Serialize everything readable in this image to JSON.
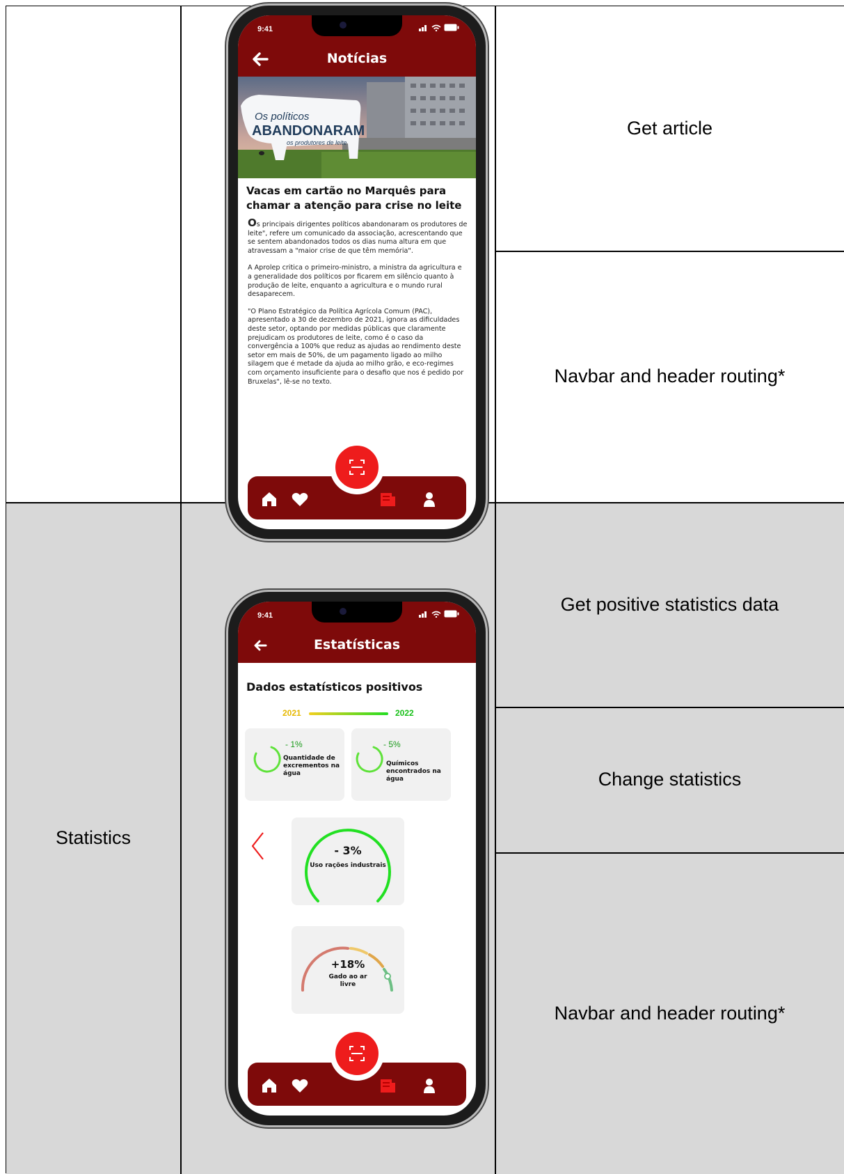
{
  "rows": [
    {
      "feature": "",
      "phone": {
        "status_time": "9:41",
        "header_title": "Notícias",
        "photo_text": {
          "line1": "Os políticos",
          "line2": "ABANDONARAM",
          "line3": "os produtores de leite"
        },
        "article_title": "Vacas em cartão no Marquês para chamar a atenção para crise no leite",
        "paragraphs": [
          {
            "dropcap": "O",
            "text": "s principais dirigentes políticos abandonaram os produtores de leite\", refere um comunicado da associação, acrescentando que se sentem abandonados todos os dias numa altura em que atravessam a \"maior crise de que têm memória\"."
          },
          {
            "dropcap": "",
            "text": "A Aprolep critica o primeiro-ministro, a ministra da agricultura e a generalidade dos políticos por ficarem em silêncio quanto à produção de leite, enquanto a agricultura e o mundo rural desaparecem."
          },
          {
            "dropcap": "",
            "text": "\"O Plano Estratégico da Política Agrícola Comum (PAC), apresentado a 30 de dezembro de 2021, ignora as dificuldades deste setor, optando por medidas públicas que claramente prejudicam os produtores de leite, como é o caso da convergência a 100% que reduz as ajudas ao rendimento deste setor em mais de 50%, de um pagamento ligado ao milho silagem que é metade da ajuda ao milho grão, e eco-regimes com orçamento insuficiente para o desafio que nos é pedido por Bruxelas\", lê-se no texto."
          }
        ]
      },
      "actions": [
        "Get article",
        "Navbar and header routing*"
      ]
    },
    {
      "feature": "Statistics",
      "phone": {
        "status_time": "9:41",
        "header_title": "Estatísticas",
        "section_title": "Dados estatísticos positivos",
        "legend": {
          "from": "2021",
          "to": "2022"
        },
        "cards": [
          {
            "value": "- 1%",
            "label": "Quantidade de excrementos na água"
          },
          {
            "value": "- 5%",
            "label": "Químicos encontrados na água"
          }
        ],
        "gauge_main": {
          "value": "- 3%",
          "label": "Uso rações industrais"
        },
        "gauge_second": {
          "value": "+18%",
          "label": "Gado ao ar livre"
        }
      },
      "actions": [
        "Get positive statistics data",
        "Change statistics",
        "Navbar and header routing*"
      ]
    }
  ],
  "colors": {
    "header": "#7e0a0a",
    "accent": "#ee1c1c",
    "positive": "#22dd22",
    "row_gray": "#d8d8d8"
  },
  "icons": [
    "back-arrow-icon",
    "home-icon",
    "heart-icon",
    "scan-icon",
    "newspaper-icon",
    "user-icon",
    "chevron-left-icon",
    "signal-icon",
    "wifi-icon",
    "battery-icon"
  ]
}
